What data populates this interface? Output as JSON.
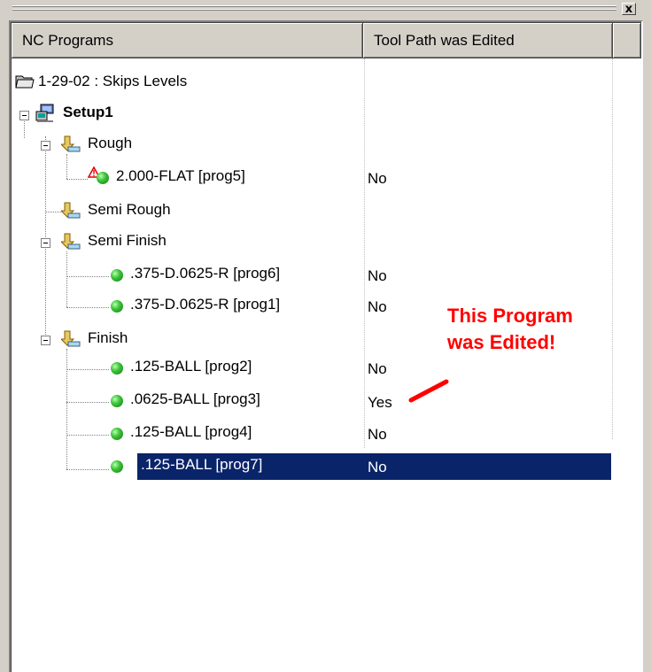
{
  "window": {
    "close_label": "x"
  },
  "columns": {
    "name": "NC Programs",
    "edited": "Tool Path was Edited"
  },
  "tree": {
    "folder": "1-29-02 : Skips Levels",
    "setup": "Setup1",
    "rough": "Rough",
    "rough_prog5": {
      "label": "2.000-FLAT [prog5]",
      "value": "No"
    },
    "semi_rough": "Semi Rough",
    "semi_finish": "Semi Finish",
    "sf_prog6": {
      "label": ".375-D.0625-R [prog6]",
      "value": "No"
    },
    "sf_prog1": {
      "label": ".375-D.0625-R [prog1]",
      "value": "No"
    },
    "finish": "Finish",
    "f_prog2": {
      "label": ".125-BALL [prog2]",
      "value": "No"
    },
    "f_prog3": {
      "label": ".0625-BALL [prog3]",
      "value": "Yes"
    },
    "f_prog4": {
      "label": ".125-BALL [prog4]",
      "value": "No"
    },
    "f_prog7": {
      "label": ".125-BALL [prog7]",
      "value": "No"
    }
  },
  "annotation": {
    "line1": "This Program",
    "line2": "was Edited!",
    "color": "#ff0000"
  },
  "colors": {
    "selection": "#0a246a",
    "ball": "#3ec43a"
  }
}
